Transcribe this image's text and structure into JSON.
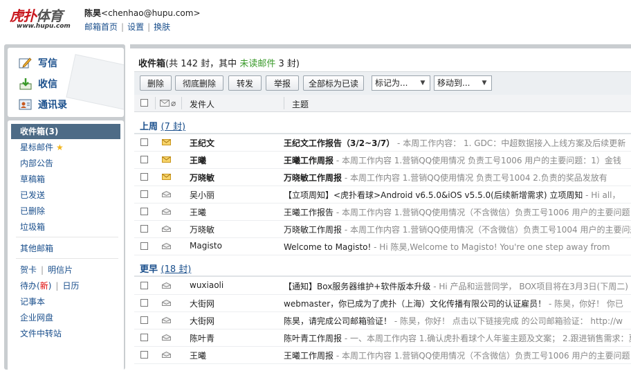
{
  "brand": {
    "logo_main": "虎扑",
    "logo_main2": "体育",
    "logo_sub": "www.hupu.com"
  },
  "user": {
    "name": "陈昊",
    "email": "<chenhao@hupu.com>"
  },
  "header_links": [
    "邮箱首页",
    "设置",
    "换肤"
  ],
  "commands": {
    "write": "写信",
    "receive": "收信",
    "contacts": "通讯录"
  },
  "folders": {
    "inbox": "收件箱(3)",
    "starred": "星标邮件",
    "internal": "内部公告",
    "drafts": "草稿箱",
    "sent": "已发送",
    "deleted": "已删除",
    "junk": "垃圾箱",
    "other": "其他邮箱",
    "card": "贺卡",
    "postcard": "明信片",
    "todo": "待办(",
    "todo_new": "新",
    "todo_end": ")",
    "calendar": "日历",
    "notes": "记事本",
    "netdisk": "企业网盘",
    "transfer": "文件中转站"
  },
  "inbox_header": {
    "title": "收件箱",
    "count_text": "(共 142 封，其中 ",
    "unread": "未读邮件",
    "unread_count": " 3 封)"
  },
  "toolbar": {
    "delete": "删除",
    "perm_delete": "彻底删除",
    "forward": "转发",
    "report": "举报",
    "mark_all_read": "全部标为已读",
    "mark_as": "标记为...",
    "move_to": "移动到..."
  },
  "columns": {
    "sender": "发件人",
    "subject": "主题"
  },
  "groups": [
    {
      "label": "上周",
      "count": "(7 封)"
    },
    {
      "label": "更早",
      "count": "(18 封)"
    }
  ],
  "emails_lastweek": [
    {
      "sender": "王纪文",
      "subject": "王纪文工作报告（3/2~3/7）",
      "preview": " -  本周工作内容： 1. GDC：中超数据接入上线方案及后续更新",
      "unread": true
    },
    {
      "sender": "王曦",
      "subject": "王曦工作周报",
      "preview": " -  本周工作内容 1.营销QQ使用情况  负责工号1006   用户的主要问题：1）金钱",
      "unread": true
    },
    {
      "sender": "万晓敏",
      "subject": "万晓敏工作周报",
      "preview": " -  本周工作内容 1.营销QQ使用情况  负责工号1004    2.负责的奖品发放有",
      "unread": true
    },
    {
      "sender": "吴小丽",
      "subject": "【立项周知】<虎扑看球>Android v6.5.0&iOS v5.5.0(后续新增需求) 立项周知",
      "preview": " -  Hi all，",
      "unread": false
    },
    {
      "sender": "王曦",
      "subject": "王曦工作报告",
      "preview": " -  本周工作内容 1.营销QQ使用情况（不含微信）负责工号1006   用户的主要问题",
      "unread": false
    },
    {
      "sender": "万晓敏",
      "subject": "万晓敏工作周报",
      "preview": " -  本周工作内容 1.营销QQ使用情况（不含微信）负责工号1004   用户的主要问题",
      "unread": false
    },
    {
      "sender": "Magisto",
      "subject": "Welcome to Magisto!",
      "preview": " -        Hi 陈昊,Welcome to Magisto!  You're one step away from",
      "unread": false
    }
  ],
  "emails_earlier": [
    {
      "sender": "wuxiaoli",
      "subject": "【通知】Box服务器维护+软件版本升级",
      "preview": " -  Hi 产品和运营同学，  BOX项目将在3月3日(下周二)",
      "unread": false
    },
    {
      "sender": "大街网",
      "subject": "webmaster，你已成为了虎扑（上海）文化传播有限公司的认证雇员！",
      "preview": " -  陈昊，你好！  你已",
      "unread": false
    },
    {
      "sender": "大街网",
      "subject": "陈昊，请完成公司邮箱验证！",
      "preview": " -  陈昊，你好！  点击以下链接完成  的公司邮箱验证：   http://w",
      "unread": false
    },
    {
      "sender": "陈叶青",
      "subject": "陈叶青工作周报",
      "preview": " -  一、本周工作内容 1.确认虎扑看球个人年鉴主题及文案； 2.跟进销售需求：夏季",
      "unread": false
    },
    {
      "sender": "王曦",
      "subject": "王曦工作周报",
      "preview": " -  本周工作内容 1.营销QQ使用情况（不含微信）负责工号1006   用户的主要问题",
      "unread": false
    }
  ]
}
